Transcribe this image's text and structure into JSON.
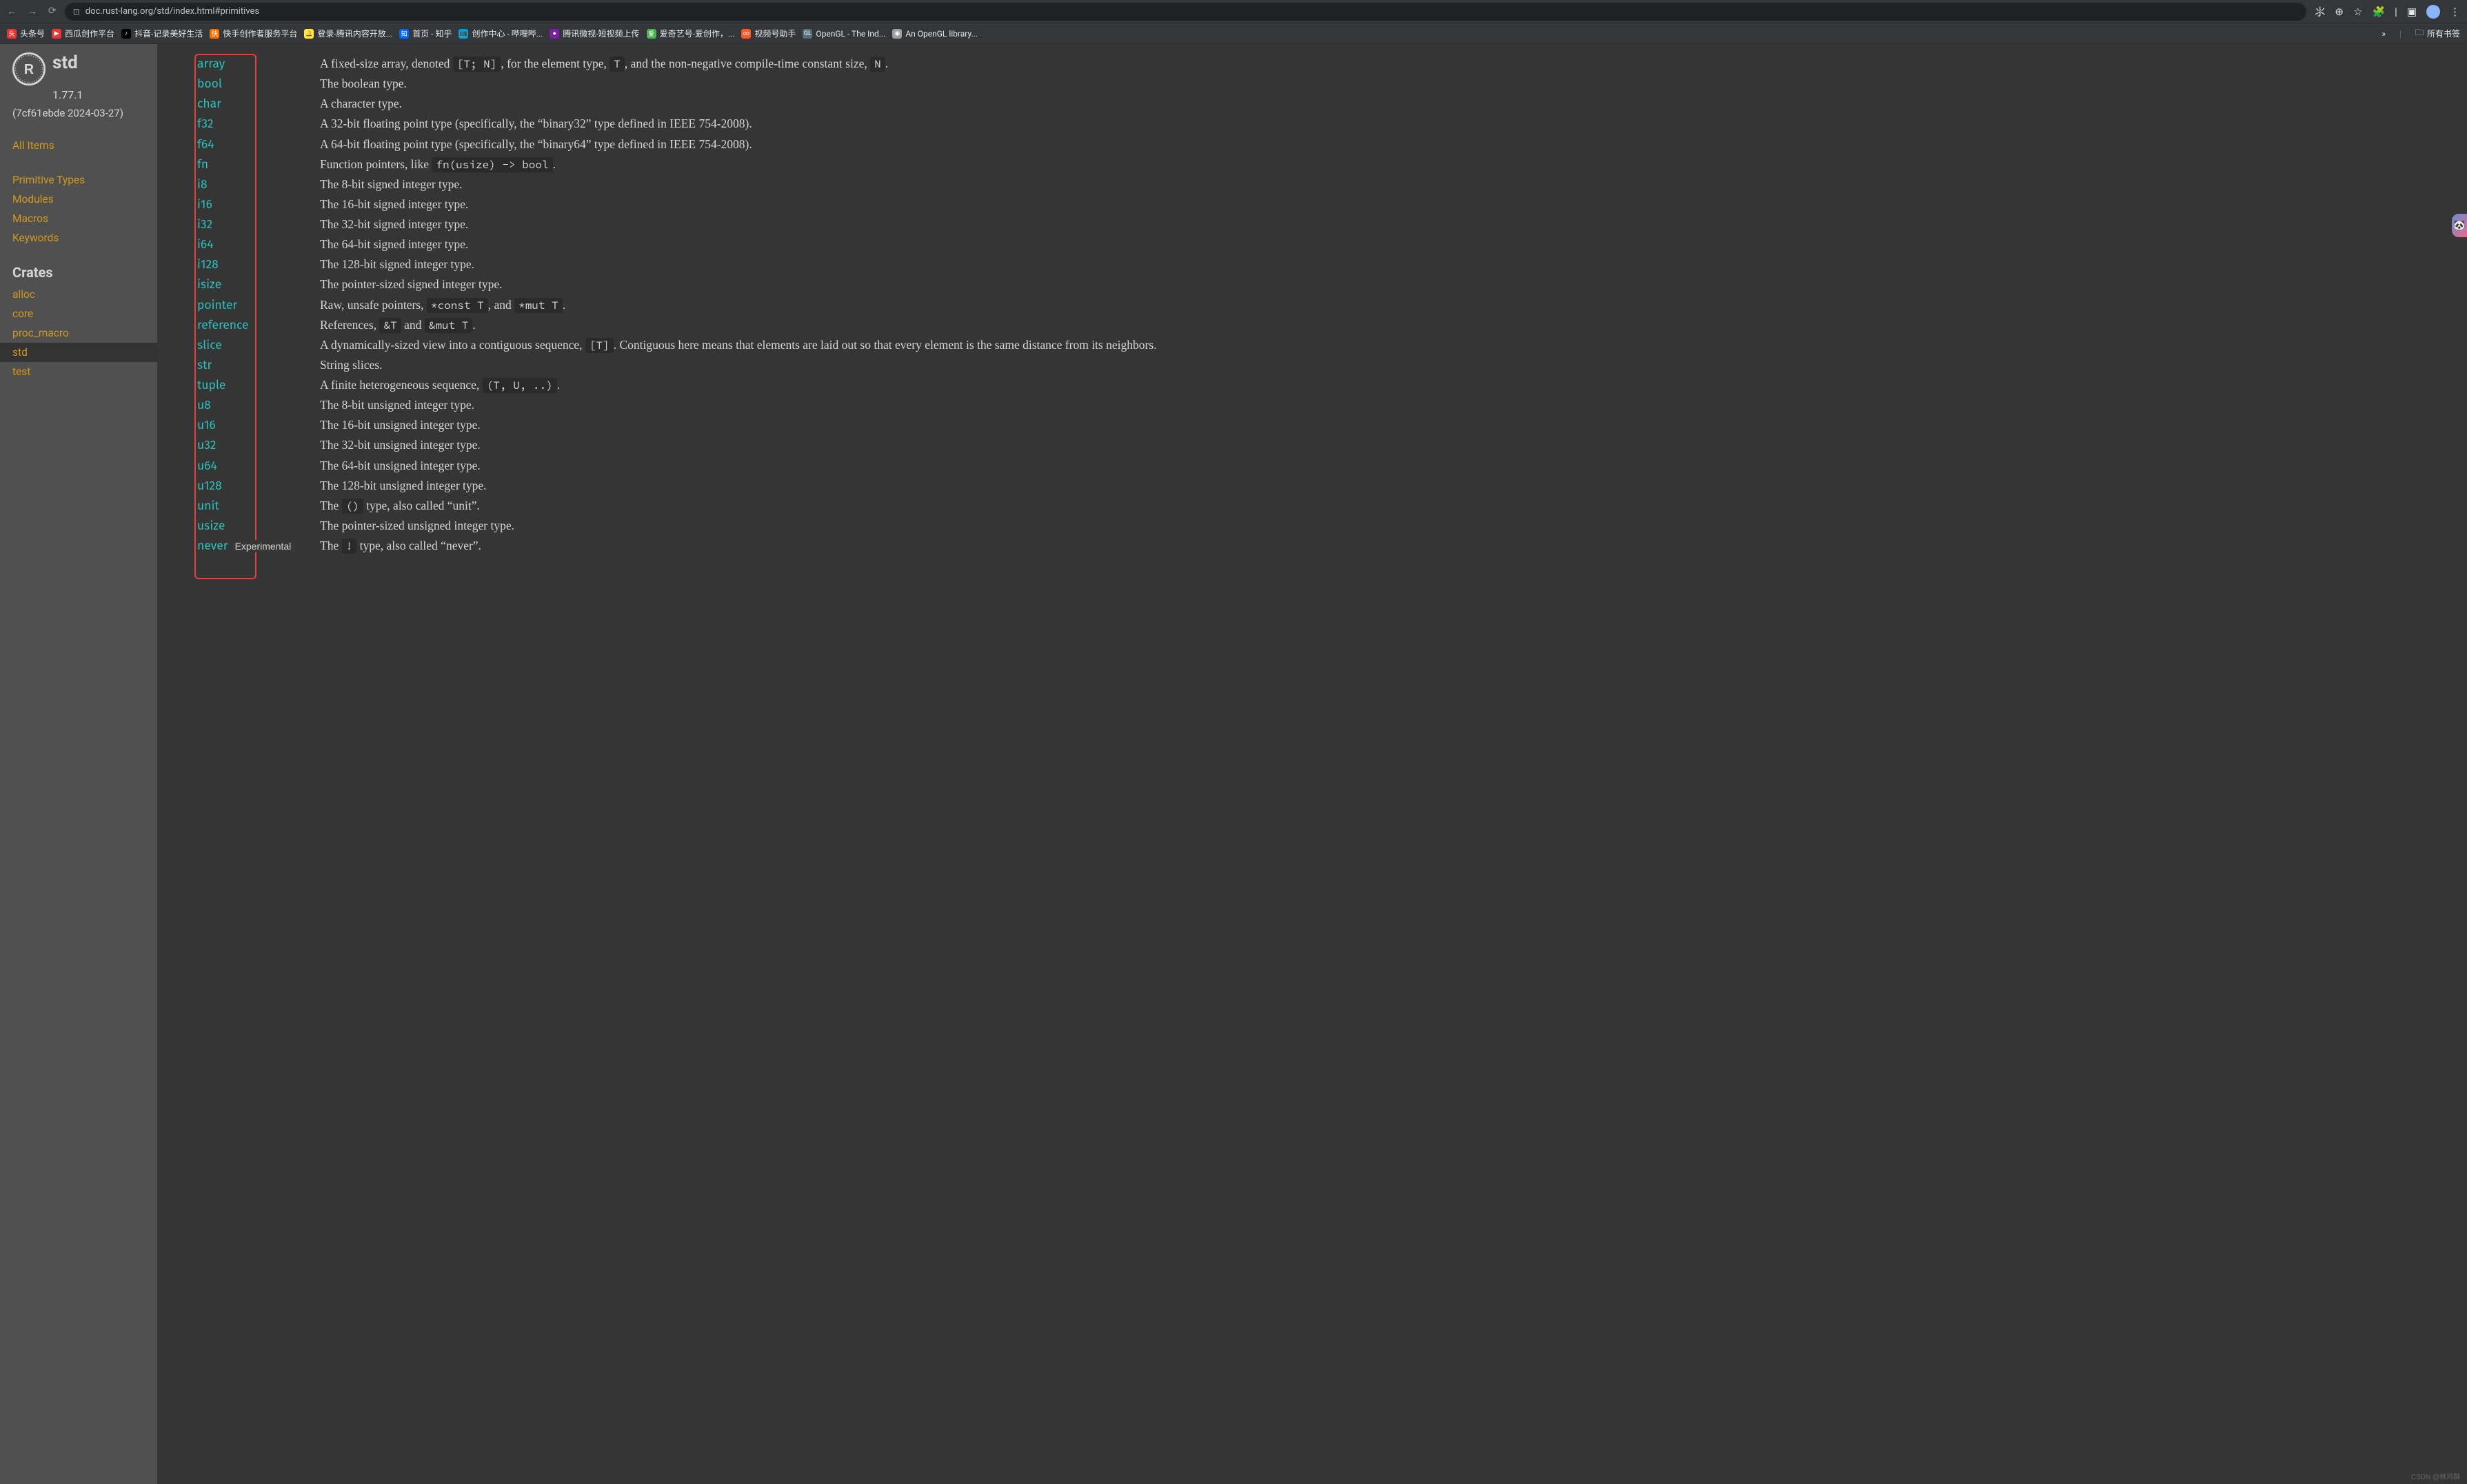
{
  "browser": {
    "url": "doc.rust-lang.org/std/index.html#primitives",
    "bookmarks": [
      {
        "icon_bg": "#e53935",
        "icon_txt": "头",
        "label": "头条号"
      },
      {
        "icon_bg": "#e53935",
        "icon_txt": "▶",
        "label": "西瓜创作平台"
      },
      {
        "icon_bg": "#000000",
        "icon_txt": "♪",
        "label": "抖音-记录美好生活"
      },
      {
        "icon_bg": "#ff6f00",
        "icon_txt": "快",
        "label": "快手创作者服务平台"
      },
      {
        "icon_bg": "#ffeb3b",
        "icon_txt": "🔔",
        "label": "登录-腾讯内容开放..."
      },
      {
        "icon_bg": "#0066ff",
        "icon_txt": "知",
        "label": "首页 - 知乎"
      },
      {
        "icon_bg": "#00a1d6",
        "icon_txt": "📺",
        "label": "创作中心 - 哔哩哔..."
      },
      {
        "icon_bg": "#7b1fa2",
        "icon_txt": "●",
        "label": "腾讯微视-短视频上传"
      },
      {
        "icon_bg": "#4caf50",
        "icon_txt": "爱",
        "label": "爱奇艺号-爱创作，..."
      },
      {
        "icon_bg": "#ff5722",
        "icon_txt": "∞",
        "label": "视频号助手"
      },
      {
        "icon_bg": "#546e7a",
        "icon_txt": "GL",
        "label": "OpenGL - The Ind..."
      },
      {
        "icon_bg": "#9e9e9e",
        "icon_txt": "◉",
        "label": "An OpenGL library..."
      }
    ],
    "all_bookmarks": "所有书签"
  },
  "sidebar": {
    "crate": "std",
    "version": "1.77.1",
    "hash": "(7cf61ebde 2024-03-27)",
    "all_items": "All Items",
    "sections": [
      "Primitive Types",
      "Modules",
      "Macros",
      "Keywords"
    ],
    "crates_head": "Crates",
    "crates": [
      "alloc",
      "core",
      "proc_macro",
      "std",
      "test"
    ]
  },
  "primitives": [
    {
      "name": "array",
      "desc_parts": [
        "A fixed-size array, denoted ",
        {
          "code": "[T; N]"
        },
        ", for the element type, ",
        {
          "code": "T"
        },
        ", and the non-negative compile-time constant size, ",
        {
          "code": "N"
        },
        "."
      ]
    },
    {
      "name": "bool",
      "desc_parts": [
        "The boolean type."
      ]
    },
    {
      "name": "char",
      "desc_parts": [
        "A character type."
      ]
    },
    {
      "name": "f32",
      "desc_parts": [
        "A 32-bit floating point type (specifically, the “binary32” type defined in IEEE 754-2008)."
      ]
    },
    {
      "name": "f64",
      "desc_parts": [
        "A 64-bit floating point type (specifically, the “binary64” type defined in IEEE 754-2008)."
      ]
    },
    {
      "name": "fn",
      "desc_parts": [
        "Function pointers, like ",
        {
          "code": "fn(usize) -> bool"
        },
        "."
      ]
    },
    {
      "name": "i8",
      "desc_parts": [
        "The 8-bit signed integer type."
      ]
    },
    {
      "name": "i16",
      "desc_parts": [
        "The 16-bit signed integer type."
      ]
    },
    {
      "name": "i32",
      "desc_parts": [
        "The 32-bit signed integer type."
      ]
    },
    {
      "name": "i64",
      "desc_parts": [
        "The 64-bit signed integer type."
      ]
    },
    {
      "name": "i128",
      "desc_parts": [
        "The 128-bit signed integer type."
      ]
    },
    {
      "name": "isize",
      "desc_parts": [
        "The pointer-sized signed integer type."
      ]
    },
    {
      "name": "pointer",
      "desc_parts": [
        "Raw, unsafe pointers, ",
        {
          "code": "*const T"
        },
        ", and ",
        {
          "code": "*mut T"
        },
        "."
      ]
    },
    {
      "name": "reference",
      "desc_parts": [
        "References, ",
        {
          "code": "&T"
        },
        " and ",
        {
          "code": "&mut T"
        },
        "."
      ]
    },
    {
      "name": "slice",
      "desc_parts": [
        "A dynamically-sized view into a contiguous sequence, ",
        {
          "code": "[T]"
        },
        ". Contiguous here means that elements are laid out so that every element is the same distance from its neighbors."
      ]
    },
    {
      "name": "str",
      "desc_parts": [
        "String slices."
      ]
    },
    {
      "name": "tuple",
      "desc_parts": [
        "A finite heterogeneous sequence, ",
        {
          "code": "(T, U, ..)"
        },
        "."
      ]
    },
    {
      "name": "u8",
      "desc_parts": [
        "The 8-bit unsigned integer type."
      ]
    },
    {
      "name": "u16",
      "desc_parts": [
        "The 16-bit unsigned integer type."
      ]
    },
    {
      "name": "u32",
      "desc_parts": [
        "The 32-bit unsigned integer type."
      ]
    },
    {
      "name": "u64",
      "desc_parts": [
        "The 64-bit unsigned integer type."
      ]
    },
    {
      "name": "u128",
      "desc_parts": [
        "The 128-bit unsigned integer type."
      ]
    },
    {
      "name": "unit",
      "desc_parts": [
        "The ",
        {
          "code": "()"
        },
        " type, also called “unit”."
      ]
    },
    {
      "name": "usize",
      "desc_parts": [
        "The pointer-sized unsigned integer type."
      ]
    },
    {
      "name": "never",
      "stab": "Experimental",
      "desc_parts": [
        "The ",
        {
          "code": "!"
        },
        " type, also called “never”."
      ]
    }
  ],
  "watermark": "CSDN @林鸿群"
}
